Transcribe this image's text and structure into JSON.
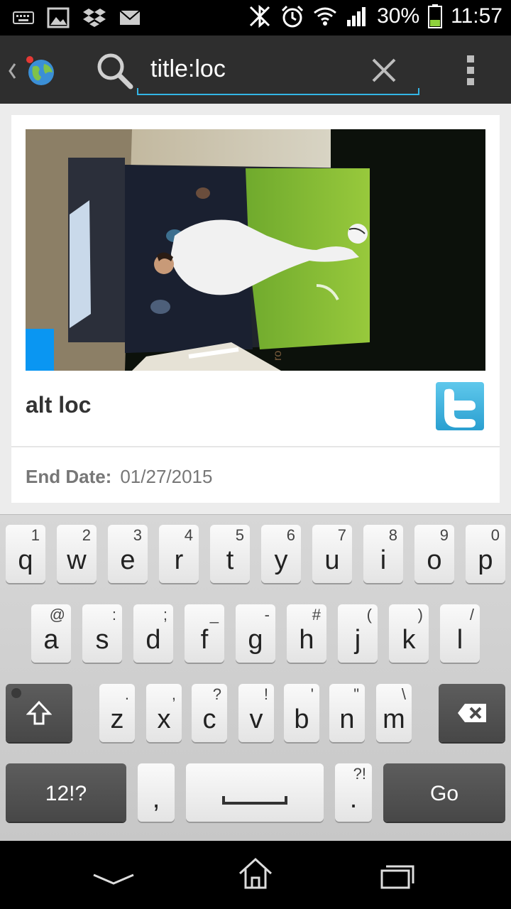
{
  "status_bar": {
    "battery_percent": "30%",
    "time": "11:57",
    "icons": [
      "keyboard-icon",
      "image-icon",
      "dropbox-icon",
      "mail-icon",
      "bluetooth-icon",
      "alarm-icon",
      "wifi-icon",
      "signal-icon",
      "battery-icon"
    ]
  },
  "action_bar": {
    "search_query": "title:loc",
    "icons": [
      "back-chevron-icon",
      "app-globe-icon",
      "search-icon",
      "clear-icon",
      "overflow-menu-icon"
    ]
  },
  "card": {
    "title": "alt loc",
    "end_date_label": "End Date:",
    "end_date_value": "01/27/2015",
    "accent": "#0a96f2",
    "share_icon": "twitter-icon"
  },
  "keyboard": {
    "row1": [
      {
        "main": "q",
        "alt": "1"
      },
      {
        "main": "w",
        "alt": "2"
      },
      {
        "main": "e",
        "alt": "3"
      },
      {
        "main": "r",
        "alt": "4"
      },
      {
        "main": "t",
        "alt": "5"
      },
      {
        "main": "y",
        "alt": "6"
      },
      {
        "main": "u",
        "alt": "7"
      },
      {
        "main": "i",
        "alt": "8"
      },
      {
        "main": "o",
        "alt": "9"
      },
      {
        "main": "p",
        "alt": "0"
      }
    ],
    "row2": [
      {
        "main": "a",
        "alt": "@"
      },
      {
        "main": "s",
        "alt": ":"
      },
      {
        "main": "d",
        "alt": ";"
      },
      {
        "main": "f",
        "alt": "_"
      },
      {
        "main": "g",
        "alt": "-"
      },
      {
        "main": "h",
        "alt": "#"
      },
      {
        "main": "j",
        "alt": "("
      },
      {
        "main": "k",
        "alt": ")"
      },
      {
        "main": "l",
        "alt": "/"
      }
    ],
    "row3": [
      {
        "main": "z",
        "alt": "."
      },
      {
        "main": "x",
        "alt": ","
      },
      {
        "main": "c",
        "alt": "?"
      },
      {
        "main": "v",
        "alt": "!"
      },
      {
        "main": "b",
        "alt": "'"
      },
      {
        "main": "n",
        "alt": "\""
      },
      {
        "main": "m",
        "alt": "\\"
      }
    ],
    "symbols_label": "12!?",
    "comma_label": ",",
    "period_label": ".",
    "period_alt": "?!",
    "go_label": "Go"
  },
  "nav_bar": {
    "icons": [
      "hide-keyboard-icon",
      "home-icon",
      "recents-icon"
    ]
  }
}
